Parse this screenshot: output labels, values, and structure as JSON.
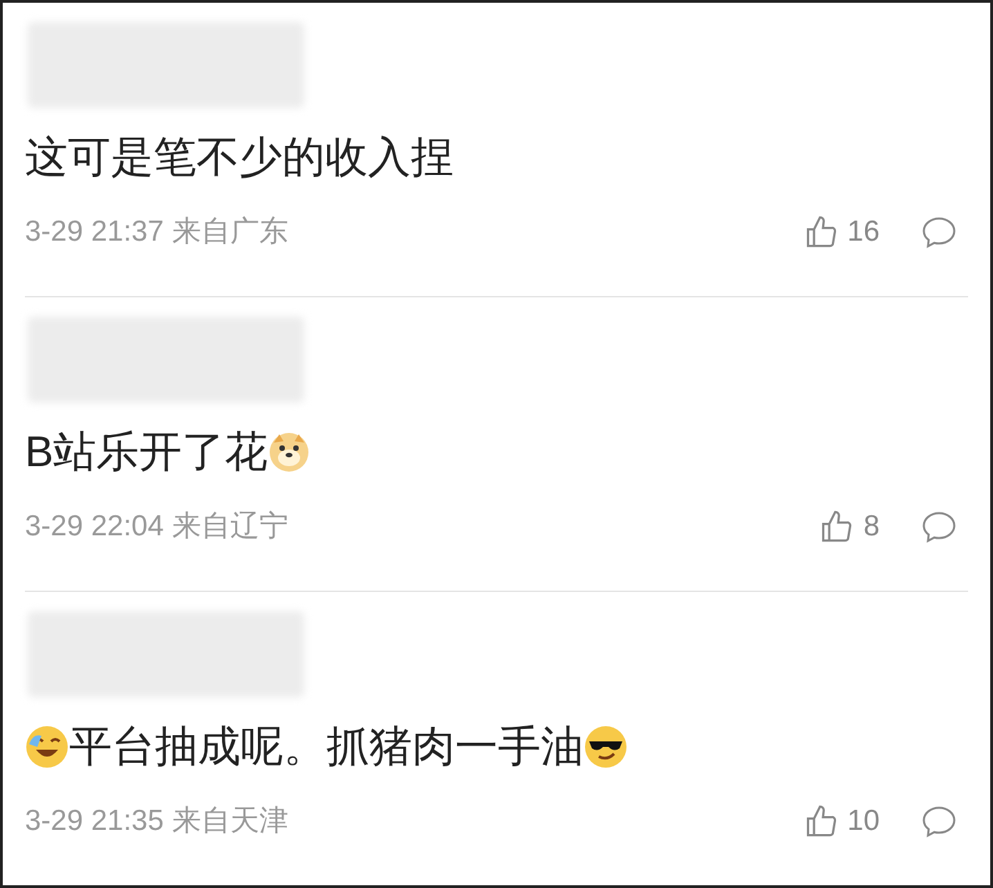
{
  "comments": [
    {
      "content": [
        {
          "kind": "text",
          "text": "这可是笔不少的收入捏"
        }
      ],
      "time": "3-29 21:37 来自广东",
      "likes": "16"
    },
    {
      "content": [
        {
          "kind": "text",
          "text": "B站乐开了花"
        },
        {
          "kind": "doge"
        }
      ],
      "time": "3-29 22:04 来自辽宁",
      "likes": "8"
    },
    {
      "content": [
        {
          "kind": "laugh"
        },
        {
          "kind": "text",
          "text": "平台抽成呢。抓猪肉一手油"
        },
        {
          "kind": "cool"
        }
      ],
      "time": "3-29 21:35 来自天津",
      "likes": "10"
    }
  ]
}
